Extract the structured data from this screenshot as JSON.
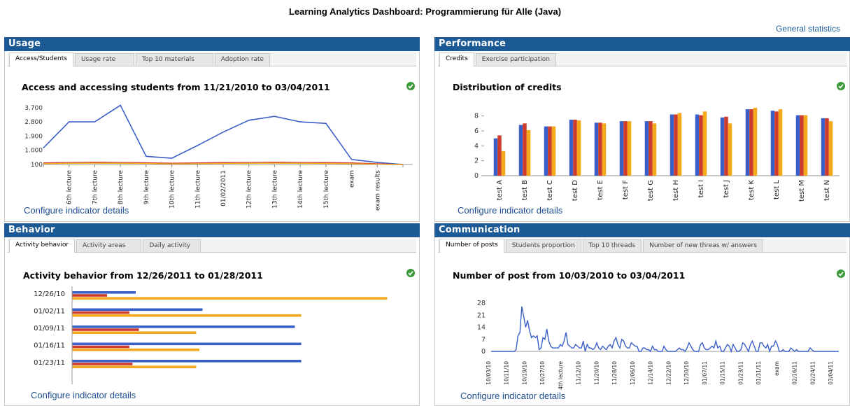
{
  "page_title": "Learning Analytics Dashboard: Programmierung für Alle (Java)",
  "general_statistics_link": "General statistics",
  "colors": {
    "header_bg": "#1c5a95",
    "link": "#1f4f8e",
    "blue": "#3a5fc8",
    "red": "#d03a2a",
    "orange": "#f4a81c",
    "ok": "#3a9a3a"
  },
  "panels": {
    "usage": {
      "title": "Usage",
      "tabs": [
        "Access/Students",
        "Usage rate",
        "Top 10 materials",
        "Adoption rate"
      ],
      "active_tab": 0,
      "chart_title": "Access and accessing students from 11/21/2010 to 03/04/2011",
      "configure": "Configure indicator details",
      "status_icon": "check-circle-icon"
    },
    "performance": {
      "title": "Performance",
      "tabs": [
        "Credits",
        "Exercise participation"
      ],
      "active_tab": 0,
      "chart_title": "Distribution of credits",
      "configure": "Configure indicator details",
      "status_icon": "check-circle-icon"
    },
    "behavior": {
      "title": "Behavior",
      "tabs": [
        "Activity behavior",
        "Activity areas",
        "Daily activity"
      ],
      "active_tab": 0,
      "chart_title": "Activity behavior from 12/26/2011 to 01/28/2011",
      "configure": "Configure indicator details",
      "status_icon": "check-circle-icon"
    },
    "communication": {
      "title": "Communication",
      "tabs": [
        "Number of posts",
        "Students proportion",
        "Top 10 threads",
        "Number of new threas w/ answers"
      ],
      "active_tab": 0,
      "chart_title": "Number of post from 10/03/2010 to 03/04/2011",
      "configure": "Configure indicator details",
      "status_icon": "check-circle-icon"
    }
  },
  "chart_data": [
    {
      "id": "usage",
      "type": "line",
      "categories": [
        "",
        "6th lecture",
        "7th lecture",
        "8th lecture",
        "9th lecture",
        "10th lecture",
        "11th lecture",
        "01/02/2011",
        "12th lecture",
        "13th lecture",
        "14th lecture",
        "15th lecture",
        "exam",
        "exam results",
        ""
      ],
      "y_ticks": [
        "100",
        "1.000",
        "1.900",
        "2.800",
        "3.700"
      ],
      "ylim": [
        100,
        4000
      ],
      "series": [
        {
          "values": [
            1150,
            2800,
            2800,
            3850,
            620,
            500,
            1300,
            2150,
            2900,
            3150,
            2800,
            2700,
            420,
            230,
            100
          ]
        },
        {
          "values": [
            200,
            230,
            240,
            230,
            210,
            180,
            200,
            220,
            230,
            240,
            230,
            220,
            200,
            150,
            100
          ]
        },
        {
          "values": [
            150,
            170,
            180,
            170,
            160,
            140,
            150,
            160,
            170,
            180,
            170,
            160,
            150,
            120,
            90
          ]
        }
      ]
    },
    {
      "id": "performance",
      "type": "bar",
      "categories": [
        "test A",
        "test B",
        "test C",
        "test D",
        "test E",
        "test F",
        "test G",
        "test H",
        "test I",
        "test J",
        "test K",
        "test L",
        "test M",
        "test N"
      ],
      "y_ticks": [
        "0",
        "2",
        "4",
        "6",
        "8"
      ],
      "ylim": [
        0,
        9
      ],
      "series": [
        {
          "values": [
            5.0,
            6.8,
            6.6,
            7.5,
            7.1,
            7.3,
            7.3,
            8.2,
            8.2,
            7.8,
            8.9,
            8.7,
            8.1,
            7.7
          ]
        },
        {
          "values": [
            5.4,
            7.0,
            6.6,
            7.5,
            7.1,
            7.3,
            7.3,
            8.2,
            8.1,
            7.9,
            8.9,
            8.6,
            8.1,
            7.7
          ]
        },
        {
          "values": [
            3.3,
            6.1,
            6.6,
            7.4,
            7.0,
            7.3,
            7.0,
            8.4,
            8.6,
            7.0,
            9.1,
            8.9,
            8.1,
            7.3
          ]
        }
      ]
    },
    {
      "id": "behavior",
      "type": "bar",
      "orientation": "horizontal",
      "categories": [
        "12/26/10",
        "01/02/11",
        "01/09/11",
        "01/16/11",
        "01/23/11"
      ],
      "xlim": [
        0,
        100
      ],
      "series": [
        {
          "values": [
            20,
            41,
            70,
            72,
            72
          ]
        },
        {
          "values": [
            11,
            18,
            21,
            18,
            19
          ]
        },
        {
          "values": [
            99,
            72,
            39,
            40,
            39
          ]
        }
      ]
    },
    {
      "id": "communication",
      "type": "line",
      "x_ticks": [
        "10/03/10",
        "10/11/10",
        "10/19/10",
        "10/27/10",
        "4th lecture",
        "11/12/10",
        "11/20/10",
        "11/28/10",
        "12/06/10",
        "12/14/10",
        "12/22/10",
        "12/30/10",
        "01/07/11",
        "01/15/11",
        "01/23/11",
        "01/31/11",
        "exam",
        "02/16/11",
        "02/24/11",
        "03/04/11"
      ],
      "y_ticks": [
        "0",
        "7",
        "14",
        "21",
        "28"
      ],
      "ylim": [
        0,
        28
      ],
      "series": [
        {
          "values": [
            0,
            0,
            0,
            0,
            0,
            0,
            0,
            0,
            0,
            0,
            0,
            0,
            0,
            1,
            9,
            11,
            26,
            20,
            14,
            18,
            12,
            8,
            9,
            8,
            9,
            1,
            2,
            8,
            7,
            13,
            6,
            3,
            2,
            2,
            2,
            2,
            4,
            3,
            6,
            11,
            4,
            3,
            2,
            2,
            4,
            3,
            2,
            2,
            6,
            0,
            4,
            2,
            2,
            1,
            2,
            5,
            2,
            1,
            3,
            2,
            1,
            3,
            4,
            2,
            6,
            8,
            4,
            2,
            7,
            6,
            3,
            2,
            2,
            5,
            4,
            3,
            3,
            0,
            0,
            2,
            2,
            1,
            1,
            0,
            3,
            1,
            1,
            0,
            0,
            0,
            3,
            1,
            0,
            0,
            0,
            0,
            0,
            1,
            2,
            1,
            1,
            0,
            2,
            5,
            3,
            1,
            0,
            0,
            0,
            4,
            5,
            2,
            1,
            1,
            2,
            3,
            2,
            6,
            2,
            3,
            0,
            0,
            2,
            4,
            3,
            0,
            4,
            2,
            0,
            0,
            1,
            5,
            4,
            2,
            0,
            4,
            6,
            3,
            0,
            0,
            5,
            5,
            3,
            2,
            4,
            0,
            3,
            3,
            6,
            4,
            0,
            0,
            1,
            0,
            0,
            0,
            2,
            1,
            0,
            1,
            0,
            0,
            0,
            0,
            0,
            0,
            2,
            1,
            0,
            0,
            0,
            0,
            0,
            0,
            0,
            0,
            0,
            0,
            0,
            0,
            0,
            0
          ]
        }
      ]
    }
  ]
}
